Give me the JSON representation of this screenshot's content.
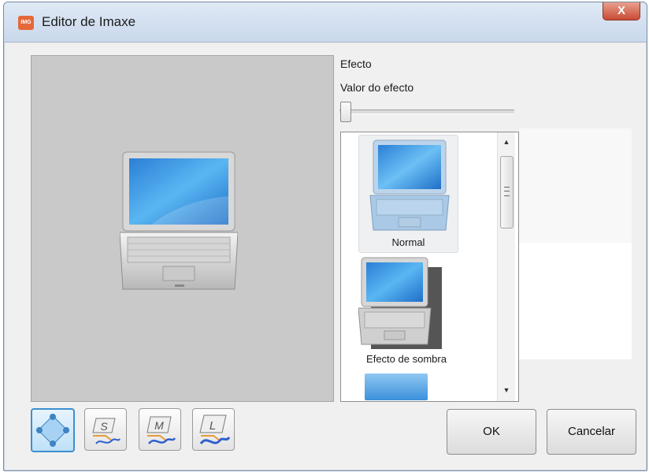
{
  "window": {
    "title": "Editor de Imaxe",
    "close_glyph": "X",
    "app_icon": "image-editor-icon"
  },
  "panel": {
    "effect_label": "Efecto",
    "effect_value_label": "Valor do efecto",
    "effect_value": 0
  },
  "effects": [
    {
      "label": "Normal",
      "selected": true
    },
    {
      "label": "Efecto de sombra",
      "selected": false
    }
  ],
  "tools": [
    {
      "icon": "fit-arrows-icon",
      "active": true
    },
    {
      "icon": "size-s-icon",
      "letter": "S"
    },
    {
      "icon": "size-m-icon",
      "letter": "M"
    },
    {
      "icon": "size-l-icon",
      "letter": "L"
    }
  ],
  "buttons": {
    "ok": "OK",
    "cancel": "Cancelar"
  },
  "colors": {
    "titlebar": "#c9d8ec",
    "close": "#c94a34",
    "active_tool": "#3d8fd0",
    "preview_bg": "#c9c9c9"
  }
}
